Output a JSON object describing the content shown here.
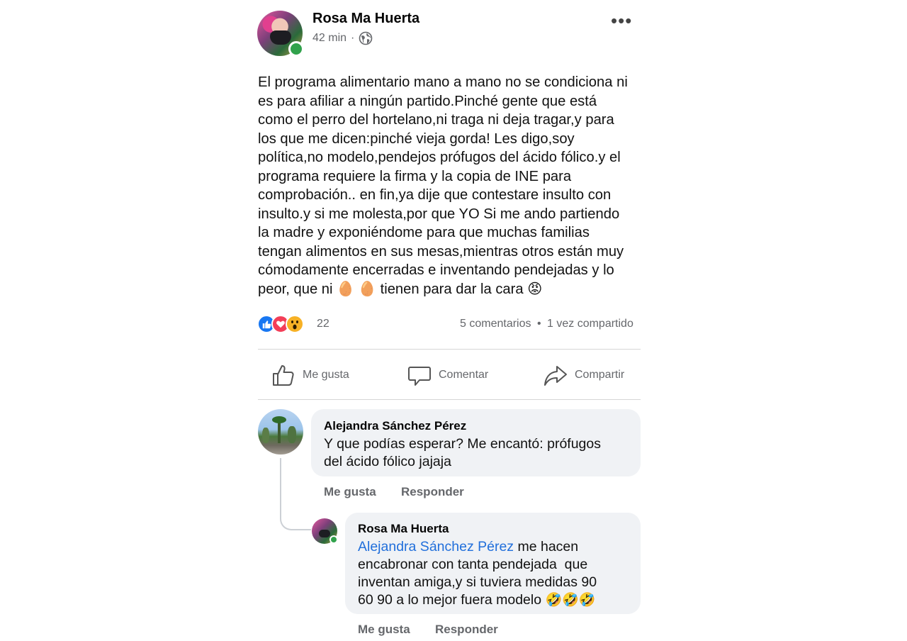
{
  "post": {
    "author": "Rosa Ma Huerta",
    "time": "42 min",
    "separator": "·",
    "more_label": "•••",
    "text": "El programa alimentario mano a mano no se condiciona ni\nes para afiliar a ningún partido.Pinché gente que está\ncomo el perro del hortelano,ni traga ni deja tragar,y para\nlos que me dicen:pinché vieja gorda! Les digo,soy\npolítica,no modelo,pendejos prófugos del ácido fólico.y el\nprograma requiere la firma y la copia de INE para\ncomprobación.. en fin,ya dije que contestare insulto con\ninsulto.y si me molesta,por que YO Si me ando partiendo\nla madre y exponiéndome para que muchas familias\ntengan alimentos en sus mesas,mientras otros están muy\ncómodamente encerradas e inventando pendejadas y lo\npeor, que ni 🥚 🥚 tienen para dar la cara 😡",
    "reaction_count": "22",
    "comments_count": "5 comentarios",
    "shares_count": "1 vez compartido",
    "counts_separator": "•"
  },
  "actions": {
    "like": "Me gusta",
    "comment": "Comentar",
    "share": "Compartir"
  },
  "comments": [
    {
      "author": "Alejandra Sánchez Pérez",
      "text": "Y que podías esperar? Me encantó: prófugos\ndel ácido fólico jajaja",
      "like": "Me gusta",
      "reply": "Responder"
    }
  ],
  "reply": {
    "author": "Rosa Ma Huerta",
    "mention": "Alejandra Sánchez Pérez",
    "text_line1": " me hacen",
    "text_rest": "encabronar con tanta pendejada  que\ninventan amiga,y si tuviera medidas 90\n60 90 a lo mejor fuera modelo ",
    "emojis": "🤣🤣🤣",
    "like": "Me gusta",
    "reply": "Responder"
  },
  "colors": {
    "like_blue": "#1877f2",
    "love_red": "#f33e58",
    "wow_yellow": "#f7b125",
    "online_green": "#31a24c",
    "mention_blue": "#216fdb",
    "bubble_bg": "#f0f2f5"
  },
  "icons": [
    "globe-icon",
    "more-icon",
    "like-reaction-icon",
    "love-reaction-icon",
    "wow-reaction-icon",
    "thumbs-up-icon",
    "comment-icon",
    "share-icon"
  ]
}
